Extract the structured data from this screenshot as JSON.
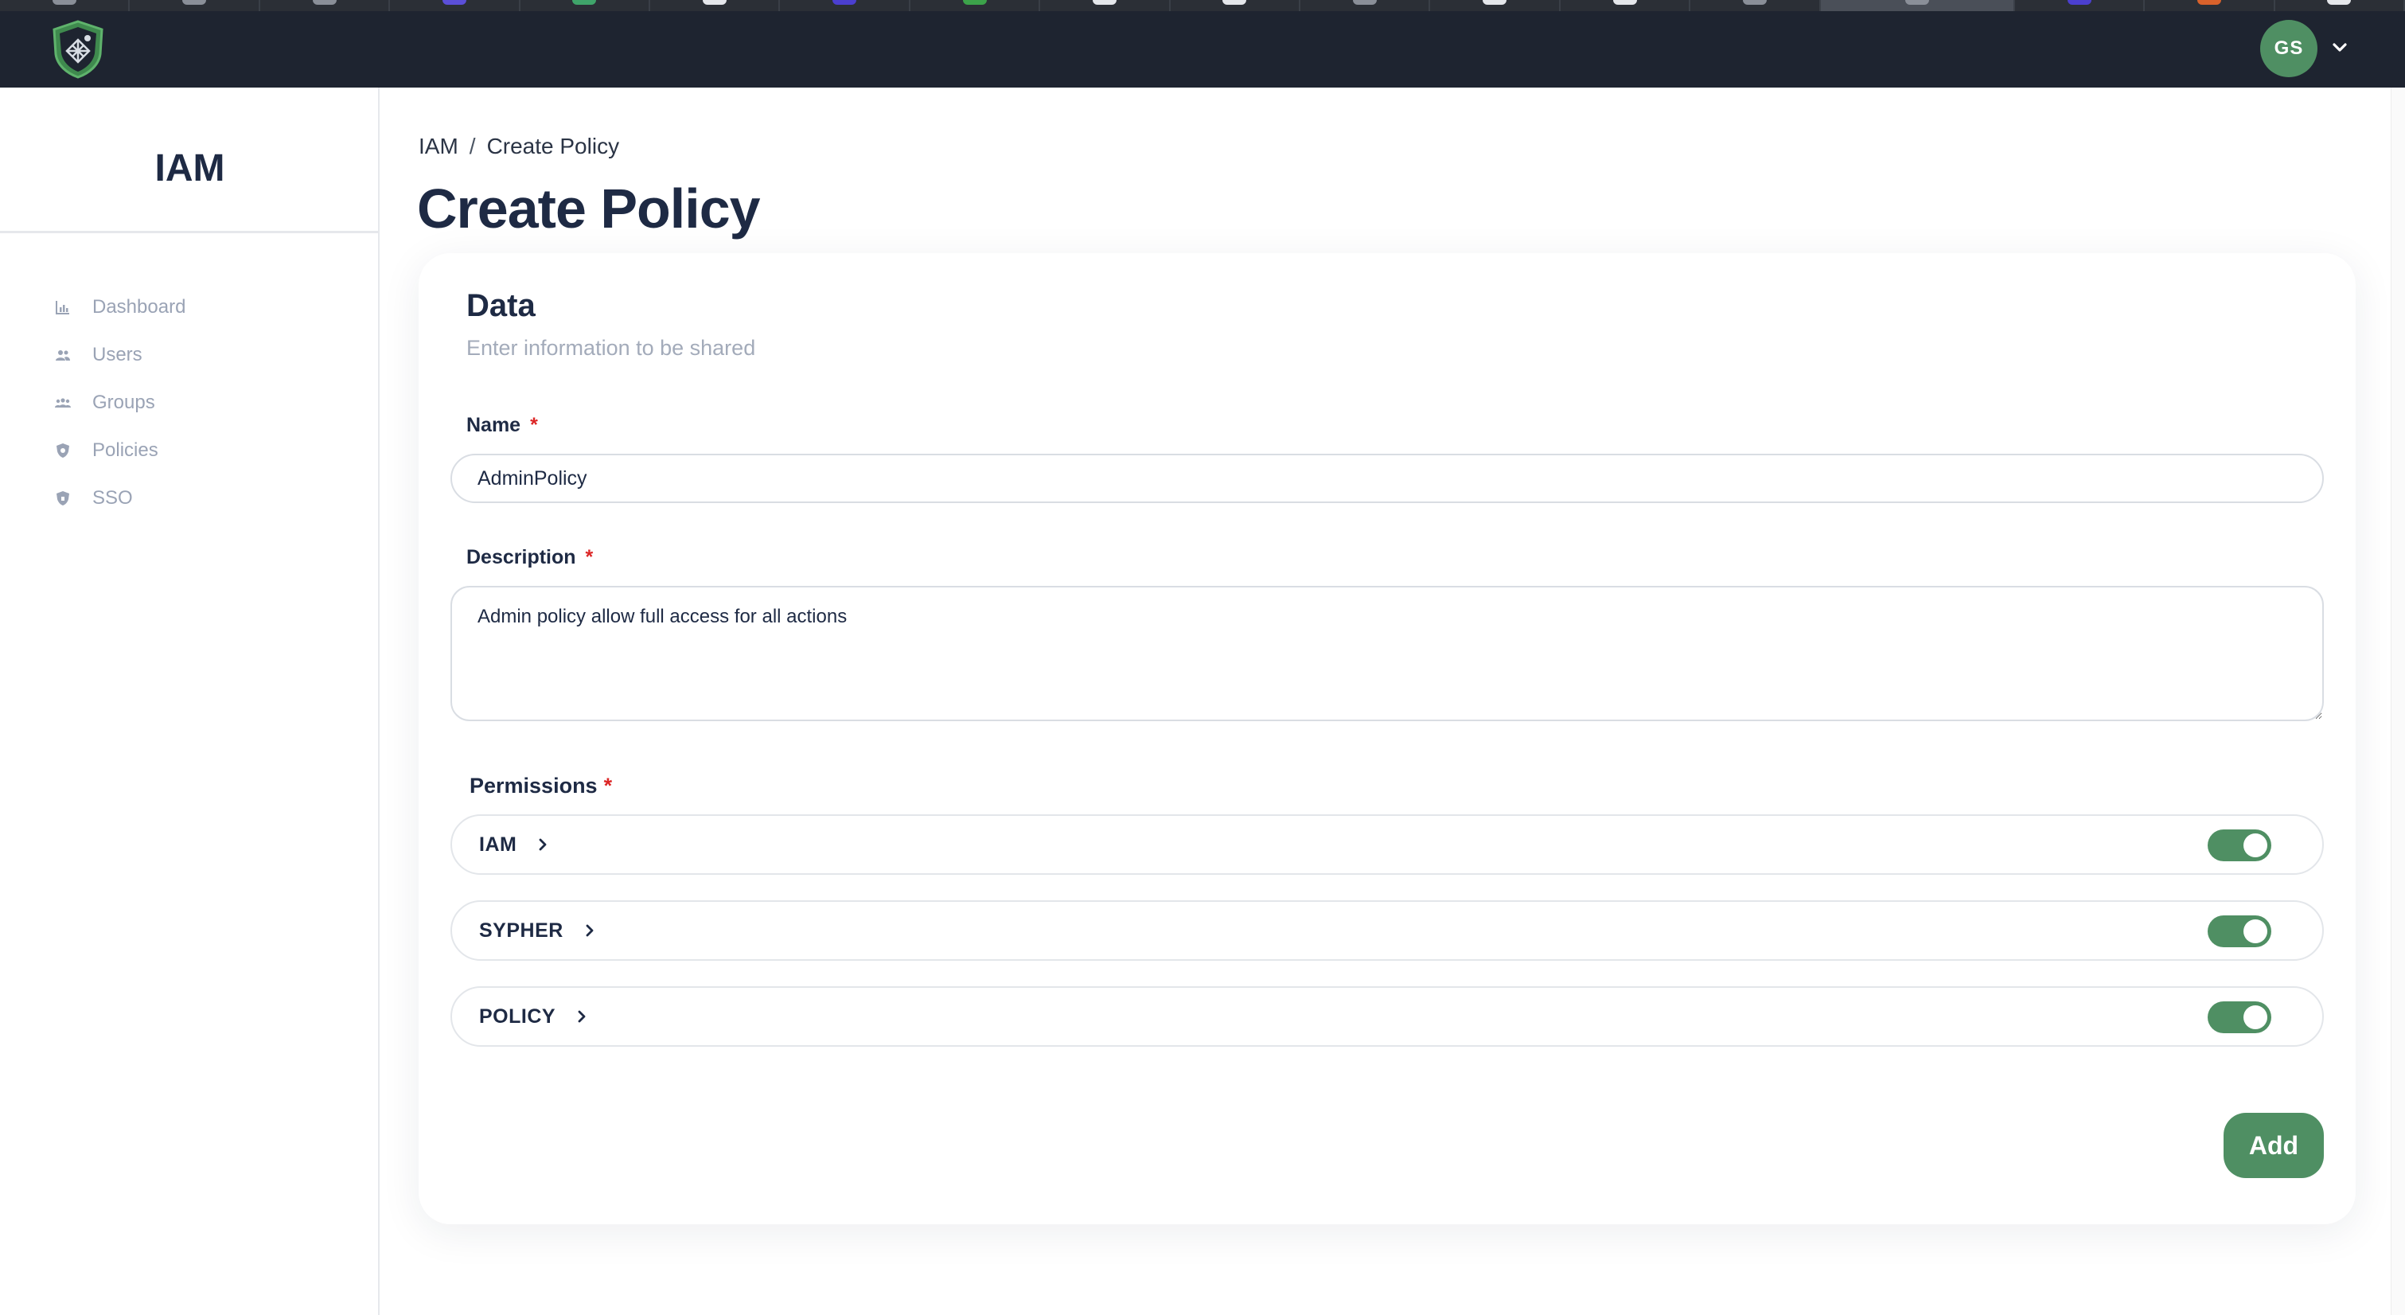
{
  "app": {
    "logo_icon": "shield-logo-icon",
    "user_initials": "GS",
    "user_menu_icon": "chevron-down-icon",
    "accent_color": "#4f8f63",
    "topbar_color": "#1e2430"
  },
  "sidebar": {
    "title": "IAM",
    "items": [
      {
        "label": "Dashboard",
        "icon": "bar-chart-icon"
      },
      {
        "label": "Users",
        "icon": "users-icon"
      },
      {
        "label": "Groups",
        "icon": "groups-icon"
      },
      {
        "label": "Policies",
        "icon": "policy-shield-icon"
      },
      {
        "label": "SSO",
        "icon": "sso-shield-icon"
      }
    ]
  },
  "breadcrumb": {
    "root": "IAM",
    "separator": "/",
    "current": "Create Policy"
  },
  "page": {
    "title": "Create Policy"
  },
  "form": {
    "section_title": "Data",
    "section_subtitle": "Enter information to be shared",
    "name_label": "Name",
    "name_value": "AdminPolicy",
    "description_label": "Description",
    "description_value": "Admin policy allow full access for all actions",
    "required_mark": "*",
    "permissions_label": "Permissions",
    "permissions": [
      {
        "name": "IAM",
        "enabled": true
      },
      {
        "name": "SYPHER",
        "enabled": true
      },
      {
        "name": "POLICY",
        "enabled": true
      }
    ],
    "add_label": "Add"
  }
}
